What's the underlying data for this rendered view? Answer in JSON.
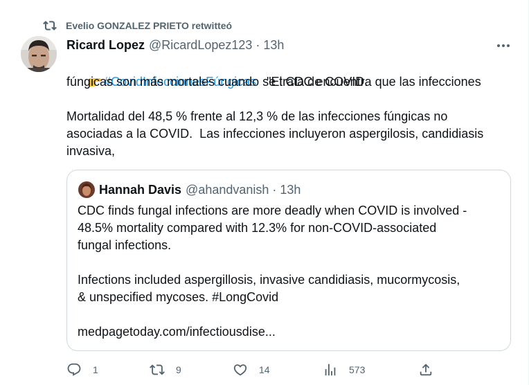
{
  "retweet": {
    "label": "Evelio GONZALEZ PRIETO retwitteó",
    "icon": "retweet-icon"
  },
  "tweet": {
    "name": "Ricard Lopez",
    "handle": "@RicardLopez123",
    "separator": "·",
    "time": "13h",
    "pointer_icon": "pointing-hand-emoji",
    "hashtag": "#CovidInfeccionesFúngicas",
    "line1_rest": "   \"El CDC encuentra que las infecciones",
    "line2": "fúngicas son más mortales cuando se trata de COVID.",
    "line3": "Mortalidad del 48,5 % frente al 12,3 % de las infecciones fúngicas no",
    "line4": "asociadas a la COVID.  Las infecciones incluyeron aspergilosis, candidiasis",
    "line5": "invasiva,"
  },
  "quote": {
    "name": "Hannah Davis",
    "handle": "@ahandvanish",
    "separator": "·",
    "time": "13h",
    "line1": "CDC finds fungal infections are more deadly when COVID is involved -",
    "line2": "48.5% mortality compared with 12.3% for non-COVID-associated",
    "line3": "fungal infections.",
    "line4": "Infections included aspergillosis, invasive candidiasis, mucormycosis,",
    "line5": "& unspecified mycoses. #LongCovid",
    "line6": "medpagetoday.com/infectiousdise..."
  },
  "actions": {
    "replies": "1",
    "retweets": "9",
    "likes": "14",
    "views": "573"
  },
  "colors": {
    "accent": "#1d9bf0",
    "secondary_text": "#536471",
    "border": "#cfd9de"
  }
}
